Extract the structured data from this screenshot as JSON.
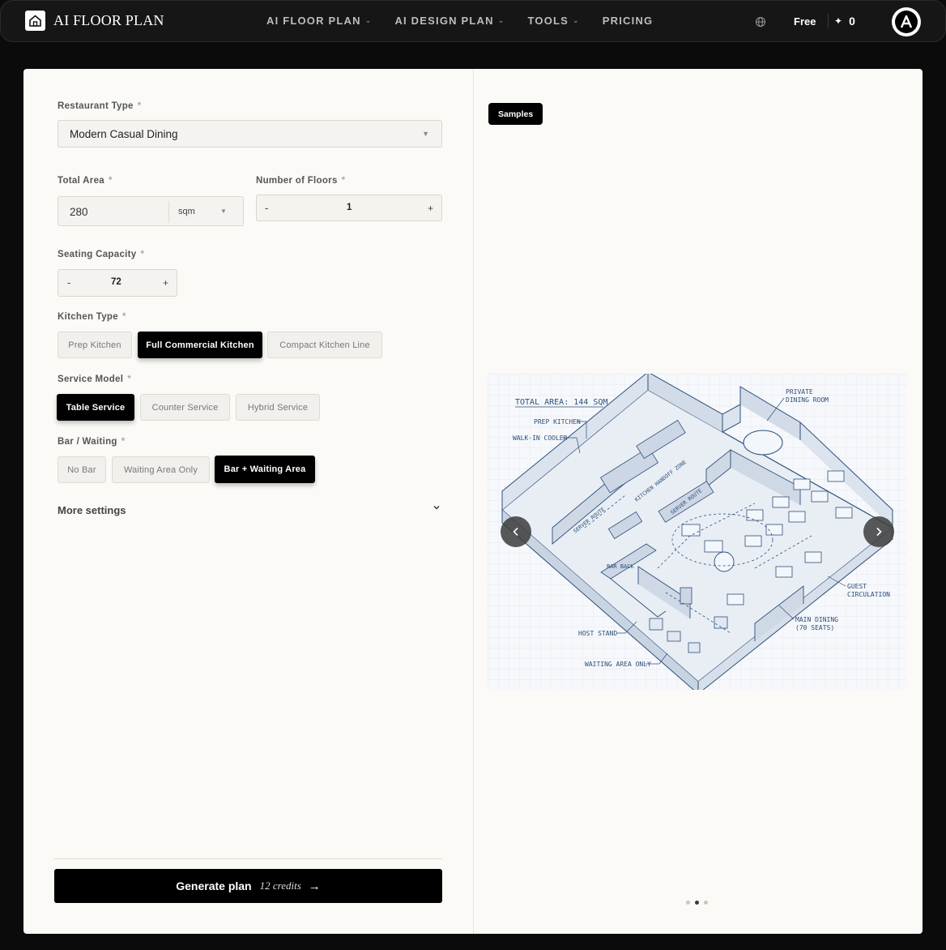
{
  "header": {
    "brand": "AI FLOOR PLAN",
    "nav": [
      {
        "label": "AI FLOOR PLAN",
        "dropdown": true
      },
      {
        "label": "AI DESIGN PLAN",
        "dropdown": true
      },
      {
        "label": "TOOLS",
        "dropdown": true
      },
      {
        "label": "PRICING",
        "dropdown": false
      }
    ],
    "plan": "Free",
    "credits": "0"
  },
  "form": {
    "restaurant_type": {
      "label": "Restaurant Type",
      "required": "*",
      "value": "Modern Casual Dining"
    },
    "total_area": {
      "label": "Total Area",
      "required": "*",
      "value": "280",
      "unit": "sqm"
    },
    "floors": {
      "label": "Number of Floors",
      "required": "*",
      "value": "1",
      "minus": "-",
      "plus": "+"
    },
    "seating": {
      "label": "Seating Capacity",
      "required": "*",
      "value": "72",
      "minus": "-",
      "plus": "+"
    },
    "kitchen_type": {
      "label": "Kitchen Type",
      "required": "*",
      "options": [
        "Prep Kitchen",
        "Full Commercial Kitchen",
        "Compact Kitchen Line"
      ],
      "selected": "Full Commercial Kitchen"
    },
    "service_model": {
      "label": "Service Model",
      "required": "*",
      "options": [
        "Table Service",
        "Counter Service",
        "Hybrid Service"
      ],
      "selected": "Table Service"
    },
    "bar_waiting": {
      "label": "Bar / Waiting",
      "required": "*",
      "options": [
        "No Bar",
        "Waiting Area Only",
        "Bar + Waiting Area"
      ],
      "selected": "Bar + Waiting Area"
    },
    "more_settings": "More settings",
    "generate": {
      "label": "Generate plan",
      "credits": "12 credits",
      "arrow": "→"
    }
  },
  "preview": {
    "badge": "Samples",
    "plan_labels": {
      "total_area": "TOTAL AREA: 144 SQM",
      "prep_kitchen": "PREP KITCHEN",
      "walk_in": "WALK-IN COOLER",
      "private_1": "PRIVATE",
      "private_2": "DINING ROOM",
      "handoff": "KITCHEN HANDOFF ZONE",
      "server_route_1": "SERVER ROUTE",
      "server_route_2": "SERVER ROUTE",
      "bar_back": "BAR BACK",
      "guest_1": "GUEST",
      "guest_2": "CIRCULATION",
      "main_1": "MAIN DINING",
      "main_2": "(70 SEATS)",
      "host": "HOST STAND",
      "waiting": "WAITING AREA ONLY"
    },
    "carousel_count": 3,
    "carousel_active": 2
  },
  "colors": {
    "accent": "#000000",
    "blueprint": "#2f4f7a",
    "card_bg": "#fbfaf6"
  }
}
